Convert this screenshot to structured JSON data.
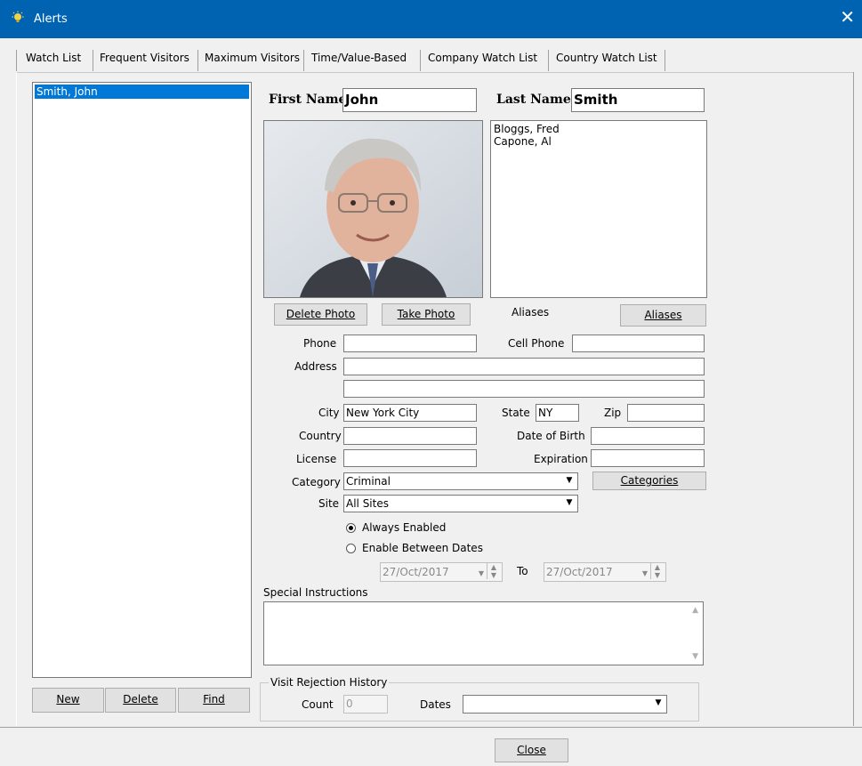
{
  "window": {
    "title": "Alerts",
    "close_glyph": "✕",
    "icon": "bulb-icon"
  },
  "tabs": [
    "Watch List",
    "Frequent Visitors",
    "Maximum Visitors",
    "Time/Value-Based",
    "Company Watch List",
    "Country Watch List"
  ],
  "watchlist": {
    "items": [
      "Smith, John"
    ]
  },
  "left_buttons": {
    "new": "New",
    "delete": "Delete",
    "find": "Find"
  },
  "person": {
    "first_name_label": "First Name",
    "first_name": "John",
    "last_name_label": "Last Name",
    "last_name": "Smith",
    "aliases": [
      "Bloggs, Fred",
      "Capone, Al"
    ],
    "aliases_label": "Aliases",
    "aliases_button": "Aliases",
    "delete_photo_button": "Delete Photo",
    "take_photo_button": "Take Photo"
  },
  "fields": {
    "phone_label": "Phone",
    "phone": "",
    "cell_label": "Cell Phone",
    "cell": "",
    "address_label": "Address",
    "address1": "",
    "address2": "",
    "city_label": "City",
    "city": "New York City",
    "state_label": "State",
    "state": "NY",
    "zip_label": "Zip",
    "zip": "",
    "country_label": "Country",
    "country": "",
    "dob_label": "Date of Birth",
    "dob": "",
    "license_label": "License",
    "license": "",
    "expiration_label": "Expiration",
    "expiration": "",
    "category_label": "Category",
    "category": "Criminal",
    "categories_button": "Categories",
    "site_label": "Site",
    "site": "All Sites"
  },
  "enable": {
    "always_label": "Always Enabled",
    "between_label": "Enable Between Dates",
    "selected": "always",
    "from_date": "27/Oct/2017",
    "to_label": "To",
    "to_date": "27/Oct/2017"
  },
  "special_instructions": {
    "label": "Special Instructions",
    "value": ""
  },
  "rejection": {
    "title": "Visit Rejection History",
    "count_label": "Count",
    "count": "0",
    "dates_label": "Dates",
    "dates": ""
  },
  "close_button": "Close"
}
